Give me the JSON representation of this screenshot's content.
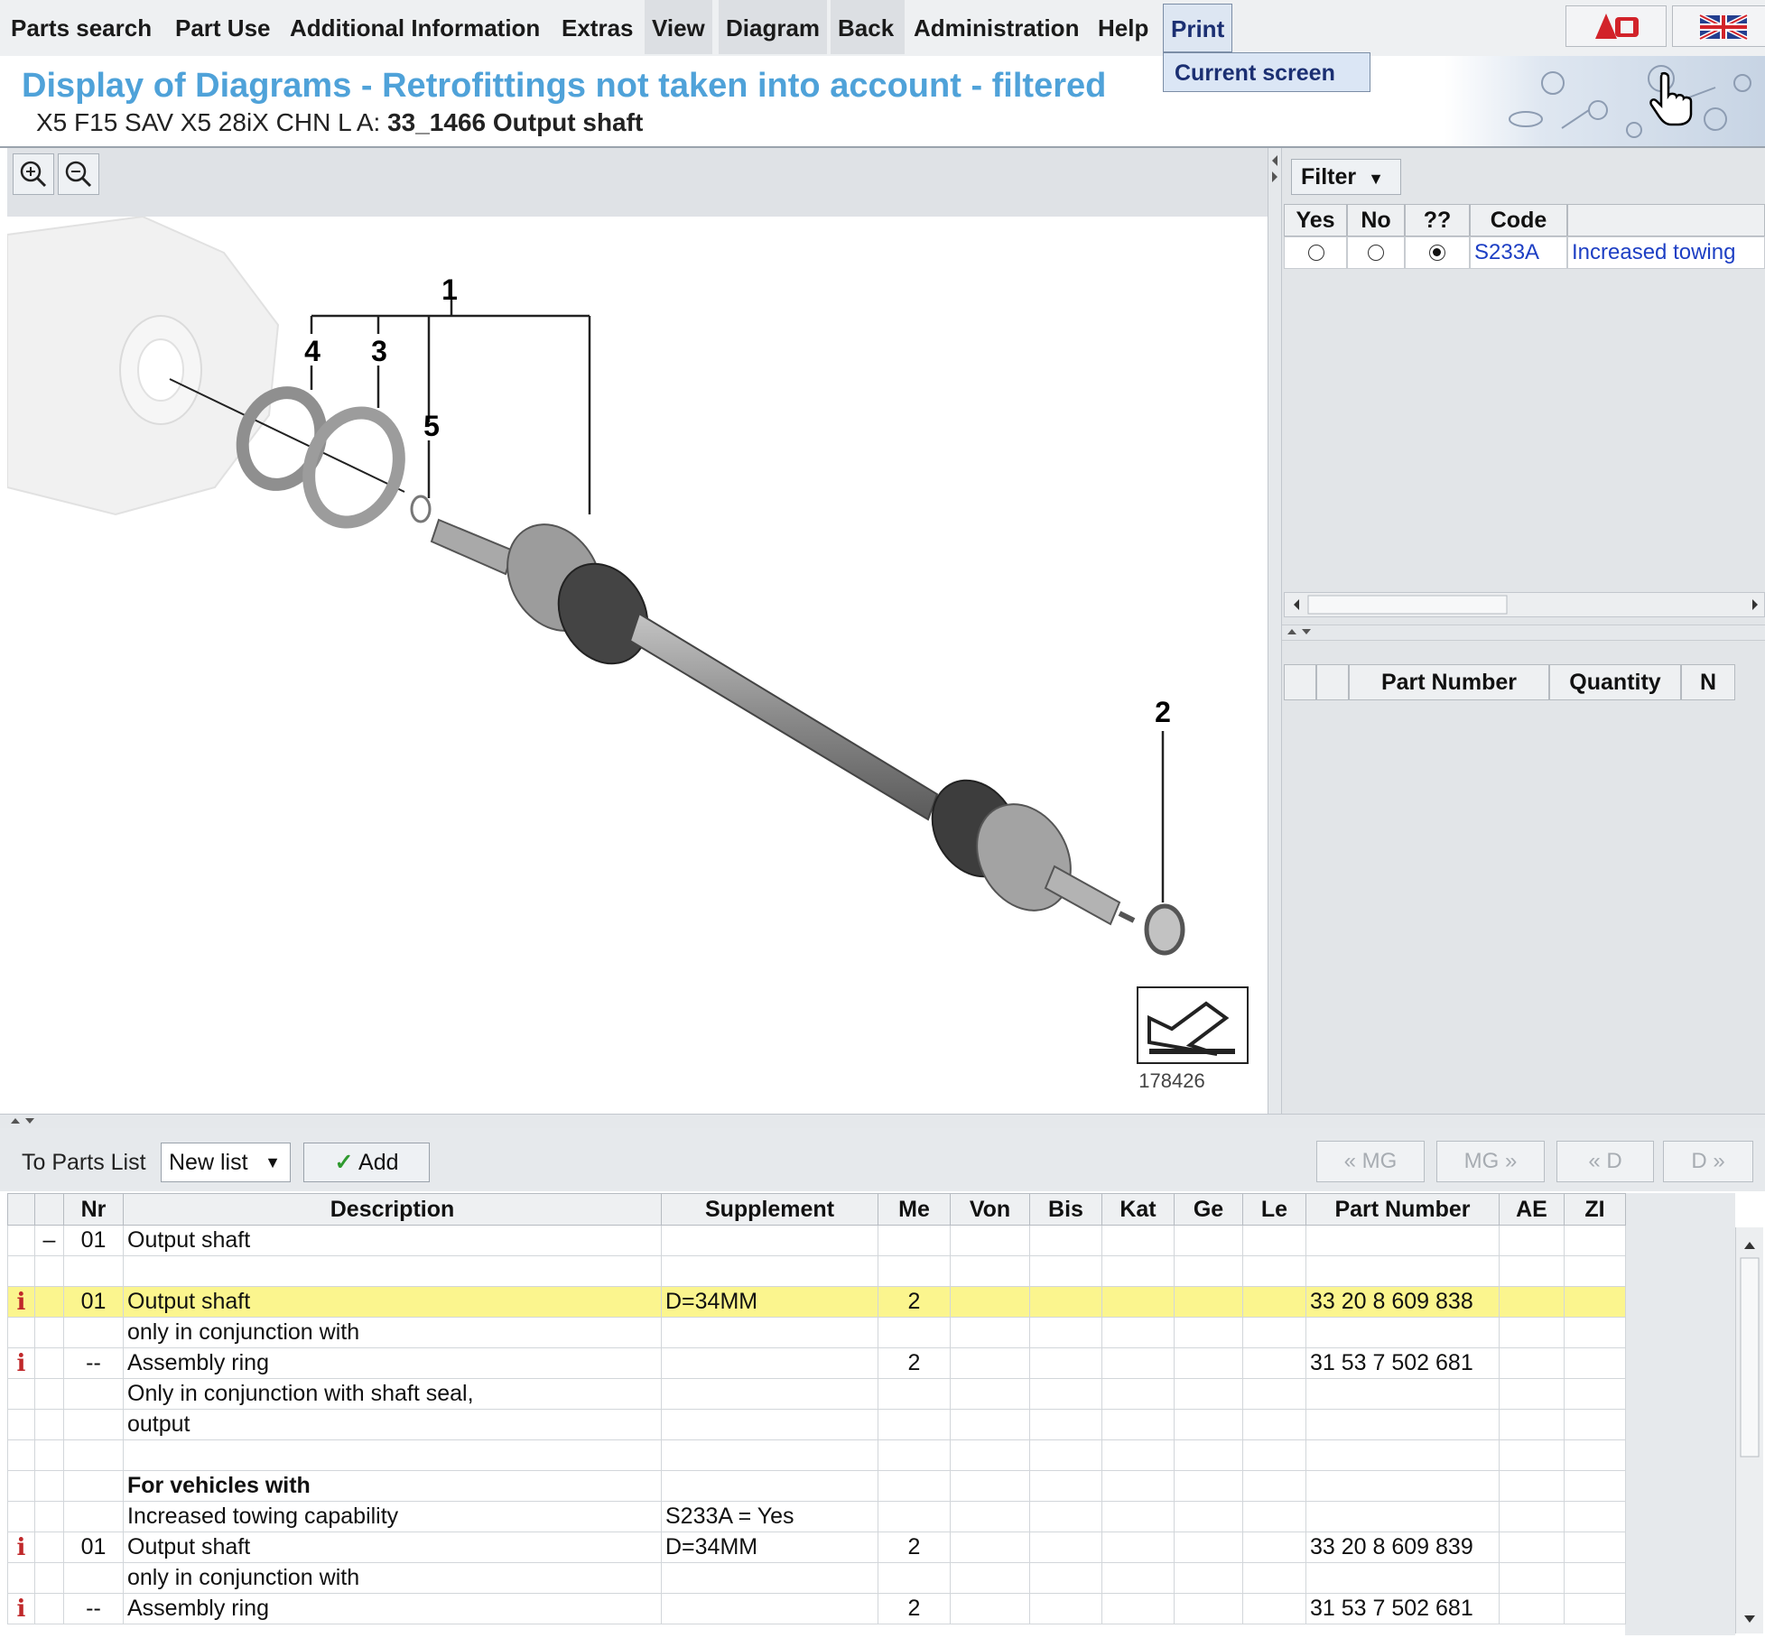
{
  "menu": {
    "items": [
      "Parts search",
      "Part Use",
      "Additional Information",
      "Extras",
      "View",
      "Diagram",
      "Back",
      "Administration",
      "Help",
      "Print"
    ],
    "print_dropdown": "Current screen"
  },
  "header": {
    "title": "Display of Diagrams - Retrofittings not taken into account - filtered",
    "vehicle": "X5 F15 SAV X5 28iX CHN  L A:",
    "diagram_name": "33_1466 Output shaft"
  },
  "diagram": {
    "callouts": [
      "1",
      "2",
      "3",
      "4",
      "5"
    ],
    "image_number": "178426"
  },
  "filter": {
    "button_label": "Filter",
    "headers": [
      "Yes",
      "No",
      "??",
      "Code"
    ],
    "rows": [
      {
        "yes": false,
        "no": false,
        "unknown": true,
        "code": "S233A",
        "description": "Increased towing"
      }
    ]
  },
  "right_table": {
    "headers": [
      "Part Number",
      "Quantity",
      "N"
    ]
  },
  "parts_toolbar": {
    "label": "To Parts List",
    "list_value": "New list",
    "add_label": "Add",
    "nav": [
      "« MG",
      "MG »",
      "« D",
      "D »"
    ]
  },
  "parts_table": {
    "headers": [
      "",
      "",
      "Nr",
      "Description",
      "Supplement",
      "Me",
      "Von",
      "Bis",
      "Kat",
      "Ge",
      "Le",
      "Part Number",
      "AE",
      "ZI"
    ],
    "rows": [
      {
        "info": "",
        "tree": "–",
        "nr": "01",
        "desc": "Output shaft",
        "supp": "",
        "me": "",
        "part": "",
        "bold": false,
        "highlight": false
      },
      {
        "info": "",
        "tree": "",
        "nr": "",
        "desc": "",
        "supp": "",
        "me": "",
        "part": "",
        "bold": false,
        "highlight": false
      },
      {
        "info": "i",
        "tree": "",
        "nr": "01",
        "desc": "Output shaft",
        "supp": "D=34MM",
        "me": "2",
        "part": "33 20 8 609 838",
        "bold": false,
        "highlight": true
      },
      {
        "info": "",
        "tree": "",
        "nr": "",
        "desc": "only in conjunction with",
        "supp": "",
        "me": "",
        "part": "",
        "bold": false,
        "highlight": false
      },
      {
        "info": "i",
        "tree": "",
        "nr": "--",
        "desc": "Assembly ring",
        "supp": "",
        "me": "2",
        "part": "31 53 7 502 681",
        "bold": false,
        "highlight": false
      },
      {
        "info": "",
        "tree": "",
        "nr": "",
        "desc": "Only in conjunction with shaft seal,",
        "supp": "",
        "me": "",
        "part": "",
        "bold": false,
        "highlight": false
      },
      {
        "info": "",
        "tree": "",
        "nr": "",
        "desc": "output",
        "supp": "",
        "me": "",
        "part": "",
        "bold": false,
        "highlight": false
      },
      {
        "info": "",
        "tree": "",
        "nr": "",
        "desc": "",
        "supp": "",
        "me": "",
        "part": "",
        "bold": false,
        "highlight": false
      },
      {
        "info": "",
        "tree": "",
        "nr": "",
        "desc": "For vehicles with",
        "supp": "",
        "me": "",
        "part": "",
        "bold": true,
        "highlight": false
      },
      {
        "info": "",
        "tree": "",
        "nr": "",
        "desc": "Increased towing capability",
        "supp": "S233A = Yes",
        "me": "",
        "part": "",
        "bold": false,
        "highlight": false
      },
      {
        "info": "i",
        "tree": "",
        "nr": "01",
        "desc": "Output shaft",
        "supp": "D=34MM",
        "me": "2",
        "part": "33 20 8 609 839",
        "bold": false,
        "highlight": false
      },
      {
        "info": "",
        "tree": "",
        "nr": "",
        "desc": "only in conjunction with",
        "supp": "",
        "me": "",
        "part": "",
        "bold": false,
        "highlight": false
      },
      {
        "info": "i",
        "tree": "",
        "nr": "--",
        "desc": "Assembly ring",
        "supp": "",
        "me": "2",
        "part": "31 53 7 502 681",
        "bold": false,
        "highlight": false
      }
    ]
  },
  "colors": {
    "title": "#4fa2d9",
    "highlight_row": "#fbf58e",
    "info_icon": "#c0282a",
    "link": "#1d3fc4"
  }
}
